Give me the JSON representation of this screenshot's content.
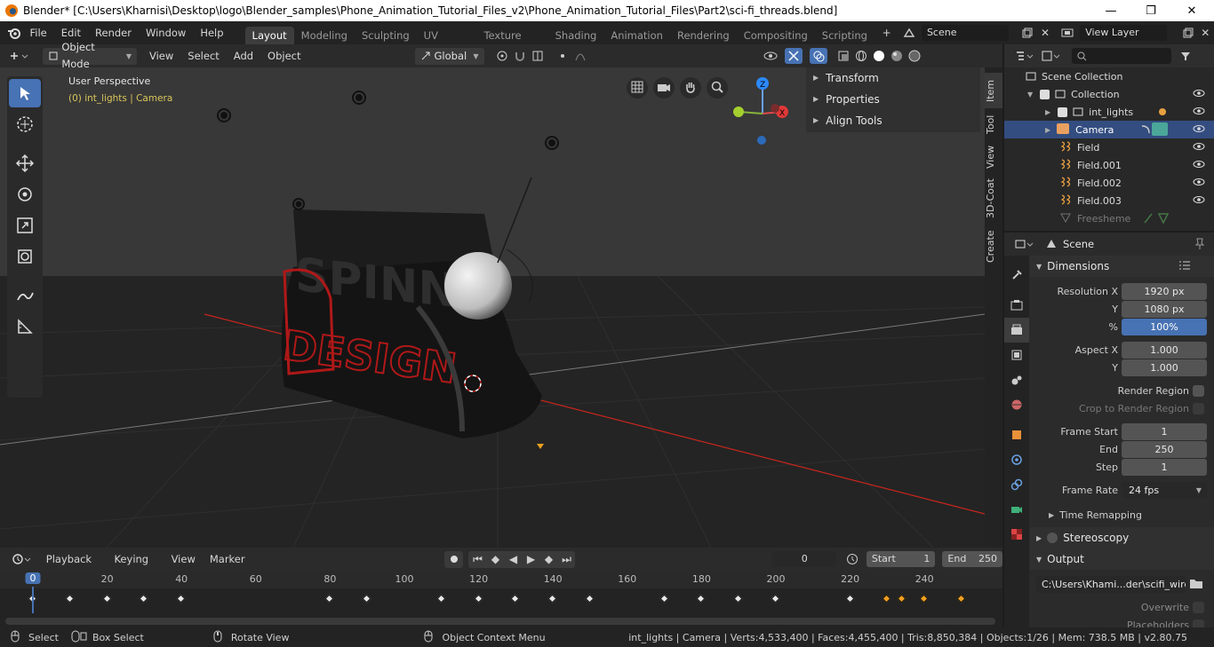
{
  "window": {
    "title": "Blender* [C:\\Users\\Kharnisi\\Desktop\\logo\\Blender_samples\\Phone_Animation_Tutorial_Files_v2\\Phone_Animation_Tutorial_Files\\Part2\\sci-fi_threads.blend]",
    "controls": [
      "—",
      "❐",
      "✕"
    ]
  },
  "menu": [
    "File",
    "Edit",
    "Render",
    "Window",
    "Help"
  ],
  "workspaces": [
    {
      "label": "Layout",
      "active": true
    },
    {
      "label": "Modeling"
    },
    {
      "label": "Sculpting"
    },
    {
      "label": "UV Editing"
    },
    {
      "label": "Texture Paint"
    },
    {
      "label": "Shading"
    },
    {
      "label": "Animation"
    },
    {
      "label": "Rendering"
    },
    {
      "label": "Compositing"
    },
    {
      "label": "Scripting"
    }
  ],
  "scene_name": "Scene",
  "view_layer": "View Layer",
  "viewport_header": {
    "mode": "Object Mode",
    "menus": [
      "View",
      "Select",
      "Add",
      "Object"
    ],
    "orientation": "Global"
  },
  "viewport": {
    "label": "User Perspective",
    "sublabel": "(0) int_lights | Camera"
  },
  "npanel": {
    "sections": [
      "Transform",
      "Properties",
      "Align Tools"
    ],
    "tabs": [
      "Item",
      "Tool",
      "View",
      "3D-Coat",
      "Create"
    ]
  },
  "outliner": {
    "root": "Scene Collection",
    "rows": [
      {
        "label": "Collection",
        "indent": 1
      },
      {
        "label": "int_lights",
        "indent": 2
      },
      {
        "label": "Camera",
        "indent": 2,
        "selected": true
      },
      {
        "label": "Field",
        "indent": 2
      },
      {
        "label": "Field.001",
        "indent": 2
      },
      {
        "label": "Field.002",
        "indent": 2
      },
      {
        "label": "Field.003",
        "indent": 2
      },
      {
        "label": "Freesheme",
        "indent": 2
      }
    ]
  },
  "properties": {
    "context": "Scene",
    "dimensions_title": "Dimensions",
    "res_x_label": "Resolution X",
    "res_x": "1920 px",
    "res_y_label": "Y",
    "res_y": "1080 px",
    "pct_label": "%",
    "pct": "100%",
    "aspect_x_label": "Aspect X",
    "aspect_x": "1.000",
    "aspect_y_label": "Y",
    "aspect_y": "1.000",
    "render_region": "Render Region",
    "crop_region": "Crop to Render Region",
    "frame_start_label": "Frame Start",
    "frame_start": "1",
    "end_label": "End",
    "end": "250",
    "step_label": "Step",
    "step": "1",
    "frame_rate_label": "Frame Rate",
    "frame_rate": "24 fps",
    "time_remap": "Time Remapping",
    "stereo": "Stereoscopy",
    "output_title": "Output",
    "output_path": "C:\\Users\\Khami...der\\scifi_wires\\",
    "overwrite": "Overwrite",
    "placeholders": "Placeholders"
  },
  "timeline": {
    "menus": [
      "Playback",
      "Keying",
      "View",
      "Marker"
    ],
    "current_frame": "0",
    "start_label": "Start",
    "start": "1",
    "end_label": "End",
    "end": "250",
    "ruler": [
      "0",
      "20",
      "40",
      "60",
      "80",
      "100",
      "120",
      "140",
      "160",
      "180",
      "200",
      "220",
      "240"
    ],
    "keyframes": [
      0,
      10,
      20,
      30,
      40,
      80,
      90,
      110,
      120,
      130,
      140,
      150,
      170,
      180,
      190,
      200,
      220,
      230,
      234,
      240,
      250
    ],
    "selected_keyframes": [
      230,
      234,
      240,
      250
    ]
  },
  "statusbar": {
    "select": "Select",
    "box_select": "Box Select",
    "rotate_view": "Rotate View",
    "context_menu": "Object Context Menu",
    "stats": "int_lights | Camera | Verts:4,533,400 | Faces:4,455,400 | Tris:8,850,384 | Objects:1/26 | Mem: 738.5 MB | v2.80.75"
  },
  "colors": {
    "accent": "#4772b3",
    "selected_row": "#334d80",
    "keyframe_selected": "#f0a020",
    "axis_red": "#c8261d"
  }
}
